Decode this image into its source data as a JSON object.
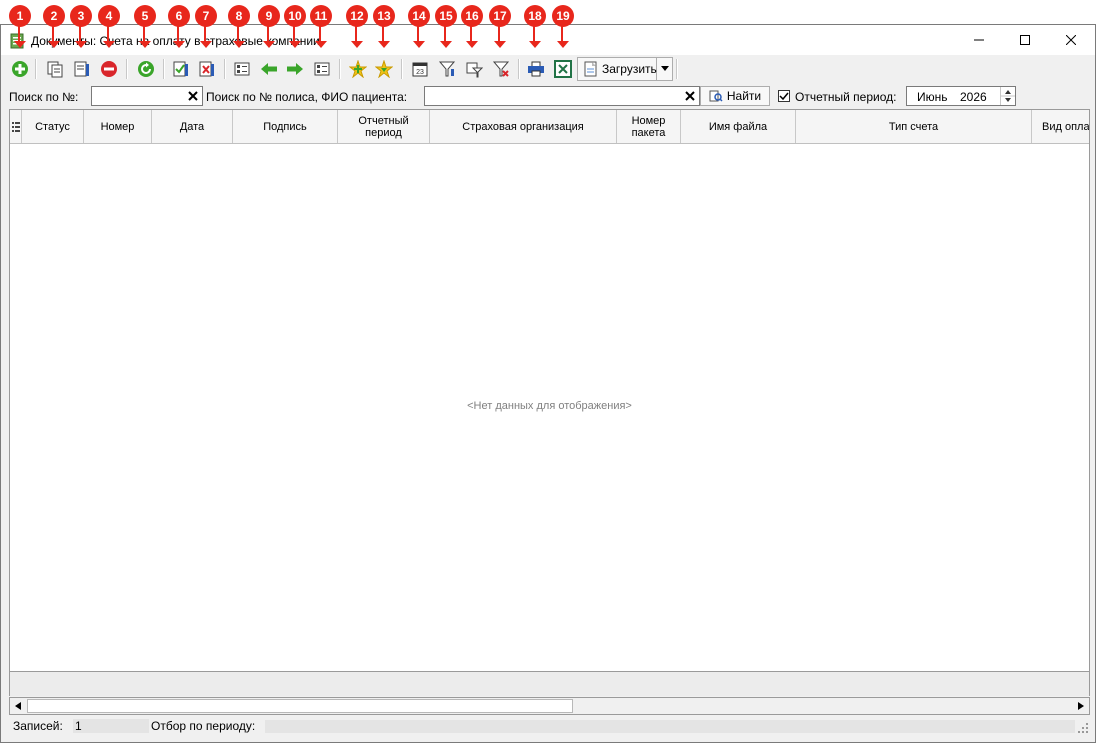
{
  "window": {
    "title": "Документы: Счета на оплату в страховые компании"
  },
  "toolbar": {
    "load_label": "Загрузить"
  },
  "search": {
    "number_label": "Поиск по №:",
    "number_value": "",
    "policy_label": "Поиск по № полиса, ФИО пациента:",
    "policy_value": "",
    "find_label": "Найти",
    "period_checked": true,
    "period_label": "Отчетный период:",
    "period_month": "Июнь",
    "period_year": "2026"
  },
  "grid": {
    "columns": [
      "Статус",
      "Номер",
      "Дата",
      "Подпись",
      "Отчетный период",
      "Страховая организация",
      "Номер пакета",
      "Имя файла",
      "Тип счета",
      "Вид оплат"
    ],
    "empty_text": "<Нет данных для отображения>"
  },
  "status": {
    "records_label": "Записей:",
    "records_value": "1",
    "filter_label": "Отбор по периоду:"
  },
  "annotations": [
    "1",
    "2",
    "3",
    "4",
    "5",
    "6",
    "7",
    "8",
    "9",
    "10",
    "11",
    "12",
    "13",
    "14",
    "15",
    "16",
    "17",
    "18",
    "19"
  ],
  "colors": {
    "badge": "#e8271c",
    "green_icon": "#3aa52a",
    "red_icon": "#d9262b"
  }
}
